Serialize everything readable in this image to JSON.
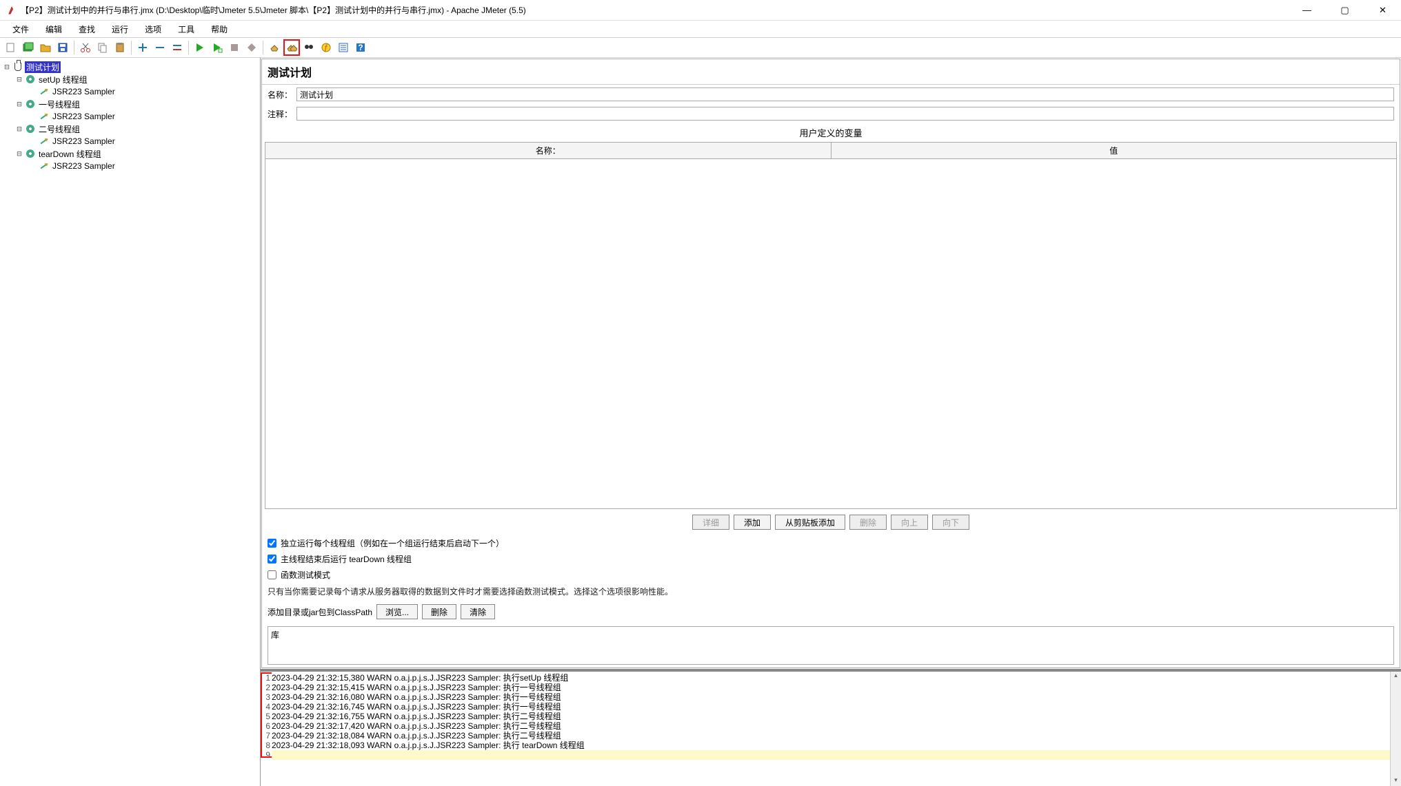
{
  "window": {
    "title": "【P2】测试计划中的并行与串行.jmx (D:\\Desktop\\临时\\Jmeter 5.5\\Jmeter 脚本\\【P2】测试计划中的并行与串行.jmx) - Apache JMeter (5.5)"
  },
  "menu": [
    "文件",
    "编辑",
    "查找",
    "运行",
    "选项",
    "工具",
    "帮助"
  ],
  "tree": {
    "root": "测试计划",
    "groups": [
      {
        "name": "setUp 线程组",
        "child": "JSR223 Sampler"
      },
      {
        "name": "一号线程组",
        "child": "JSR223 Sampler"
      },
      {
        "name": "二号线程组",
        "child": "JSR223 Sampler"
      },
      {
        "name": "tearDown 线程组",
        "child": "JSR223 Sampler"
      }
    ]
  },
  "editor": {
    "heading": "测试计划",
    "name_label": "名称：",
    "name_value": "测试计划",
    "comment_label": "注释：",
    "comment_value": "",
    "vars_title": "用户定义的变量",
    "col_name": "名称：",
    "col_value": "值",
    "buttons": {
      "detail": "详细",
      "add": "添加",
      "paste": "从剪贴板添加",
      "delete": "删除",
      "up": "向上",
      "down": "向下"
    },
    "chk1": "独立运行每个线程组（例如在一个组运行结束后启动下一个）",
    "chk2": "主线程结束后运行 tearDown 线程组",
    "chk3": "函数测试模式",
    "note": "只有当你需要记录每个请求从服务器取得的数据到文件时才需要选择函数测试模式。选择这个选项很影响性能。",
    "cp_label": "添加目录或jar包到ClassPath",
    "cp_browse": "浏览...",
    "cp_delete": "删除",
    "cp_clear": "清除",
    "lib_label": "库"
  },
  "log": [
    "2023-04-29 21:32:15,380 WARN o.a.j.p.j.s.J.JSR223 Sampler: 执行setUp 线程组",
    "2023-04-29 21:32:15,415 WARN o.a.j.p.j.s.J.JSR223 Sampler: 执行一号线程组",
    "2023-04-29 21:32:16,080 WARN o.a.j.p.j.s.J.JSR223 Sampler: 执行一号线程组",
    "2023-04-29 21:32:16,745 WARN o.a.j.p.j.s.J.JSR223 Sampler: 执行一号线程组",
    "2023-04-29 21:32:16,755 WARN o.a.j.p.j.s.J.JSR223 Sampler: 执行二号线程组",
    "2023-04-29 21:32:17,420 WARN o.a.j.p.j.s.J.JSR223 Sampler: 执行二号线程组",
    "2023-04-29 21:32:18,084 WARN o.a.j.p.j.s.J.JSR223 Sampler: 执行二号线程组",
    "2023-04-29 21:32:18,093 WARN o.a.j.p.j.s.J.JSR223 Sampler: 执行 tearDown 线程组"
  ]
}
